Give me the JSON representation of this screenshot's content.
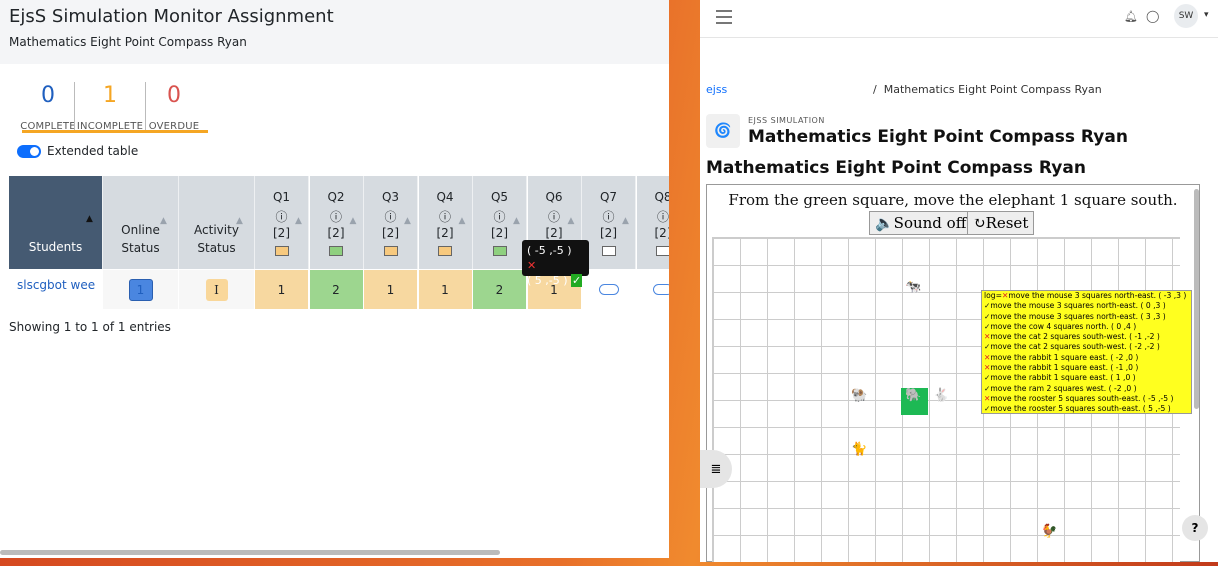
{
  "left": {
    "title": "EjsS Simulation Monitor Assignment",
    "subtitle": "Mathematics Eight Point Compass Ryan",
    "counts": [
      {
        "n": "0",
        "label": "COMPLETE",
        "color": "#1f5fbf"
      },
      {
        "n": "1",
        "label": "INCOMPLETE",
        "color": "#f5a623"
      },
      {
        "n": "0",
        "label": "OVERDUE",
        "color": "#d9534f"
      }
    ],
    "toggle": "Extended table",
    "headers": {
      "students": "Students",
      "online": "Online\nStatus",
      "activity": "Activity\nStatus"
    },
    "questions": [
      {
        "q": "Q1",
        "pts": "[2]",
        "color": "#f7c97e"
      },
      {
        "q": "Q2",
        "pts": "[2]",
        "color": "#8fd07f"
      },
      {
        "q": "Q3",
        "pts": "[2]",
        "color": "#f7c97e"
      },
      {
        "q": "Q4",
        "pts": "[2]",
        "color": "#f7c97e"
      },
      {
        "q": "Q5",
        "pts": "[2]",
        "color": "#8fd07f"
      },
      {
        "q": "Q6",
        "pts": "[2]",
        "color": "#f7c97e"
      },
      {
        "q": "Q7",
        "pts": "[2]",
        "color": "#ffffff"
      },
      {
        "q": "Q8",
        "pts": "[2]",
        "color": "#ffffff"
      }
    ],
    "info_icon": "ⓘ",
    "row": {
      "student": "slscgbot wee",
      "online": "1",
      "activity": "I",
      "scores": [
        "1",
        "2",
        "1",
        "1",
        "2",
        "1",
        "",
        ""
      ],
      "score_colors": [
        "#f7d8a0",
        "#9dd68f",
        "#f7d8a0",
        "#f7d8a0",
        "#9dd68f",
        "#f7d8a0",
        "#ffffff",
        "#ffffff"
      ]
    },
    "tooltip": {
      "line1": "( -5 ,-5 )",
      "line2": "( 5 ,-5 )",
      "mark1": "✕",
      "mark2": "✓"
    },
    "entries": "Showing 1 to 1 of 1 entries"
  },
  "right": {
    "breadcrumb_root": "ejss",
    "breadcrumb_sep": "/",
    "breadcrumb_page": "Mathematics Eight Point Compass Ryan",
    "avatar": "SW",
    "small_label": "EJSS SIMULATION",
    "ejss_title": "Mathematics Eight Point Compass Ryan",
    "page_title": "Mathematics Eight Point Compass Ryan",
    "instruction": "From the green square,  move the elephant 1 square south.",
    "sound_btn": "🔈Sound off",
    "reset_btn": "↻Reset",
    "log": [
      {
        "m": "✕",
        "t": "move the mouse 3 squares north-east. ( -3 ,3 )",
        "pre": "log="
      },
      {
        "m": "✓",
        "t": "move the mouse 3 squares north-east. ( 0 ,3 )"
      },
      {
        "m": "✓",
        "t": "move the mouse 3 squares north-east. ( 3 ,3 )"
      },
      {
        "m": "✓",
        "t": "move the cow 4 squares north. ( 0 ,4 )"
      },
      {
        "m": "✕",
        "t": "move the cat 2 squares south-west. ( -1 ,-2 )"
      },
      {
        "m": "✓",
        "t": "move the cat 2 squares south-west. ( -2 ,-2 )"
      },
      {
        "m": "✕",
        "t": "move the rabbit 1 square east. ( -2 ,0 )"
      },
      {
        "m": "✕",
        "t": "move the rabbit 1 square east. ( -1 ,0 )"
      },
      {
        "m": "✓",
        "t": "move the rabbit 1 square east. ( 1 ,0 )"
      },
      {
        "m": "✓",
        "t": "move the ram 2 squares west. ( -2 ,0 )"
      },
      {
        "m": "✕",
        "t": "move the rooster 5 squares south-east. ( -5 ,-5 )"
      },
      {
        "m": "✓",
        "t": "move the rooster 5 squares south-east. ( 5 ,-5 )"
      }
    ],
    "help": "?"
  }
}
